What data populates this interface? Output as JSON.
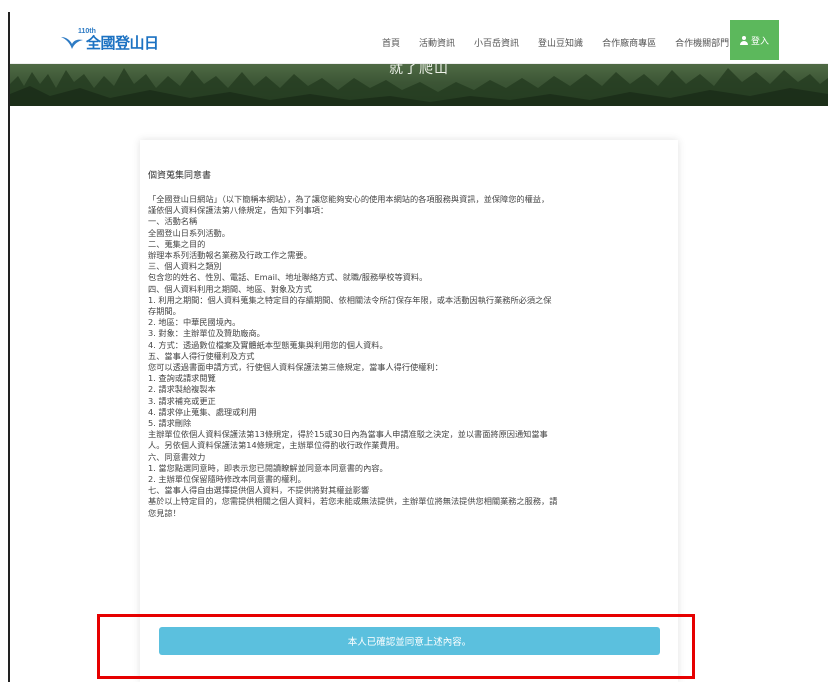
{
  "header": {
    "logo_small": "110th",
    "logo_text": "全國登山日",
    "nav": [
      "首頁",
      "活動資訊",
      "小百岳資訊",
      "登山豆知識",
      "合作廠商專區",
      "合作機關部門"
    ],
    "login_label": "登入"
  },
  "banner": {
    "title": "就了爬山"
  },
  "consent": {
    "title": "個資蒐集同意書",
    "body": "「全國登山日網站」（以下簡稱本網站），為了讓您能夠安心的使用本網站的各項服務與資訊，並保障您的權益，\n謹依個人資料保護法第八條規定，告知下列事項：\n一、活動名稱\n全國登山日系列活動。\n二、蒐集之目的\n辦理本系列活動報名業務及行政工作之需要。\n三、個人資料之類別\n包含您的姓名、性別、電話、Email、地址聯絡方式、就職/服務學校等資料。\n四、個人資料利用之期間、地區、對象及方式\n1. 利用之期間：個人資料蒐集之特定目的存續期間、依相關法令所訂保存年限，或本活動因執行業務所必須之保\n存期間。\n2. 地區：中華民國境內。\n3. 對象：主辦單位及贊助廠商。\n4. 方式：透過數位檔案及實體紙本型態蒐集與利用您的個人資料。\n五、當事人得行使權利及方式\n您可以透過書面申請方式，行使個人資料保護法第三條規定，當事人得行使權利：\n1. 查詢或請求閱覽\n2. 請求製給複製本\n3. 請求補充或更正\n4. 請求停止蒐集、處理或利用\n5. 請求刪除\n主辦單位依個人資料保護法第13條規定，得於15或30日內為當事人申請准駁之決定，並以書面將原因通知當事\n人。另依個人資料保護法第14條規定，主辦單位得酌收行政作業費用。\n六、同意書效力\n1. 當您點選同意時，即表示您已閱讀瞭解並同意本同意書的內容。\n2. 主辦單位保留隨時修改本同意書的權利。\n七、當事人得自由選擇提供個人資料，不提供將對其權益影響\n基於以上特定目的，您需提供相關之個人資料，若您未能或無法提供，主辦單位將無法提供您相關業務之服務，請\n您見諒！",
    "confirm_label": "本人已確認並同意上述內容。"
  },
  "colors": {
    "login_green": "#5cb85c",
    "confirm_blue": "#5bc0de",
    "highlight_red": "#e60000",
    "logo_blue": "#1c72c2"
  }
}
